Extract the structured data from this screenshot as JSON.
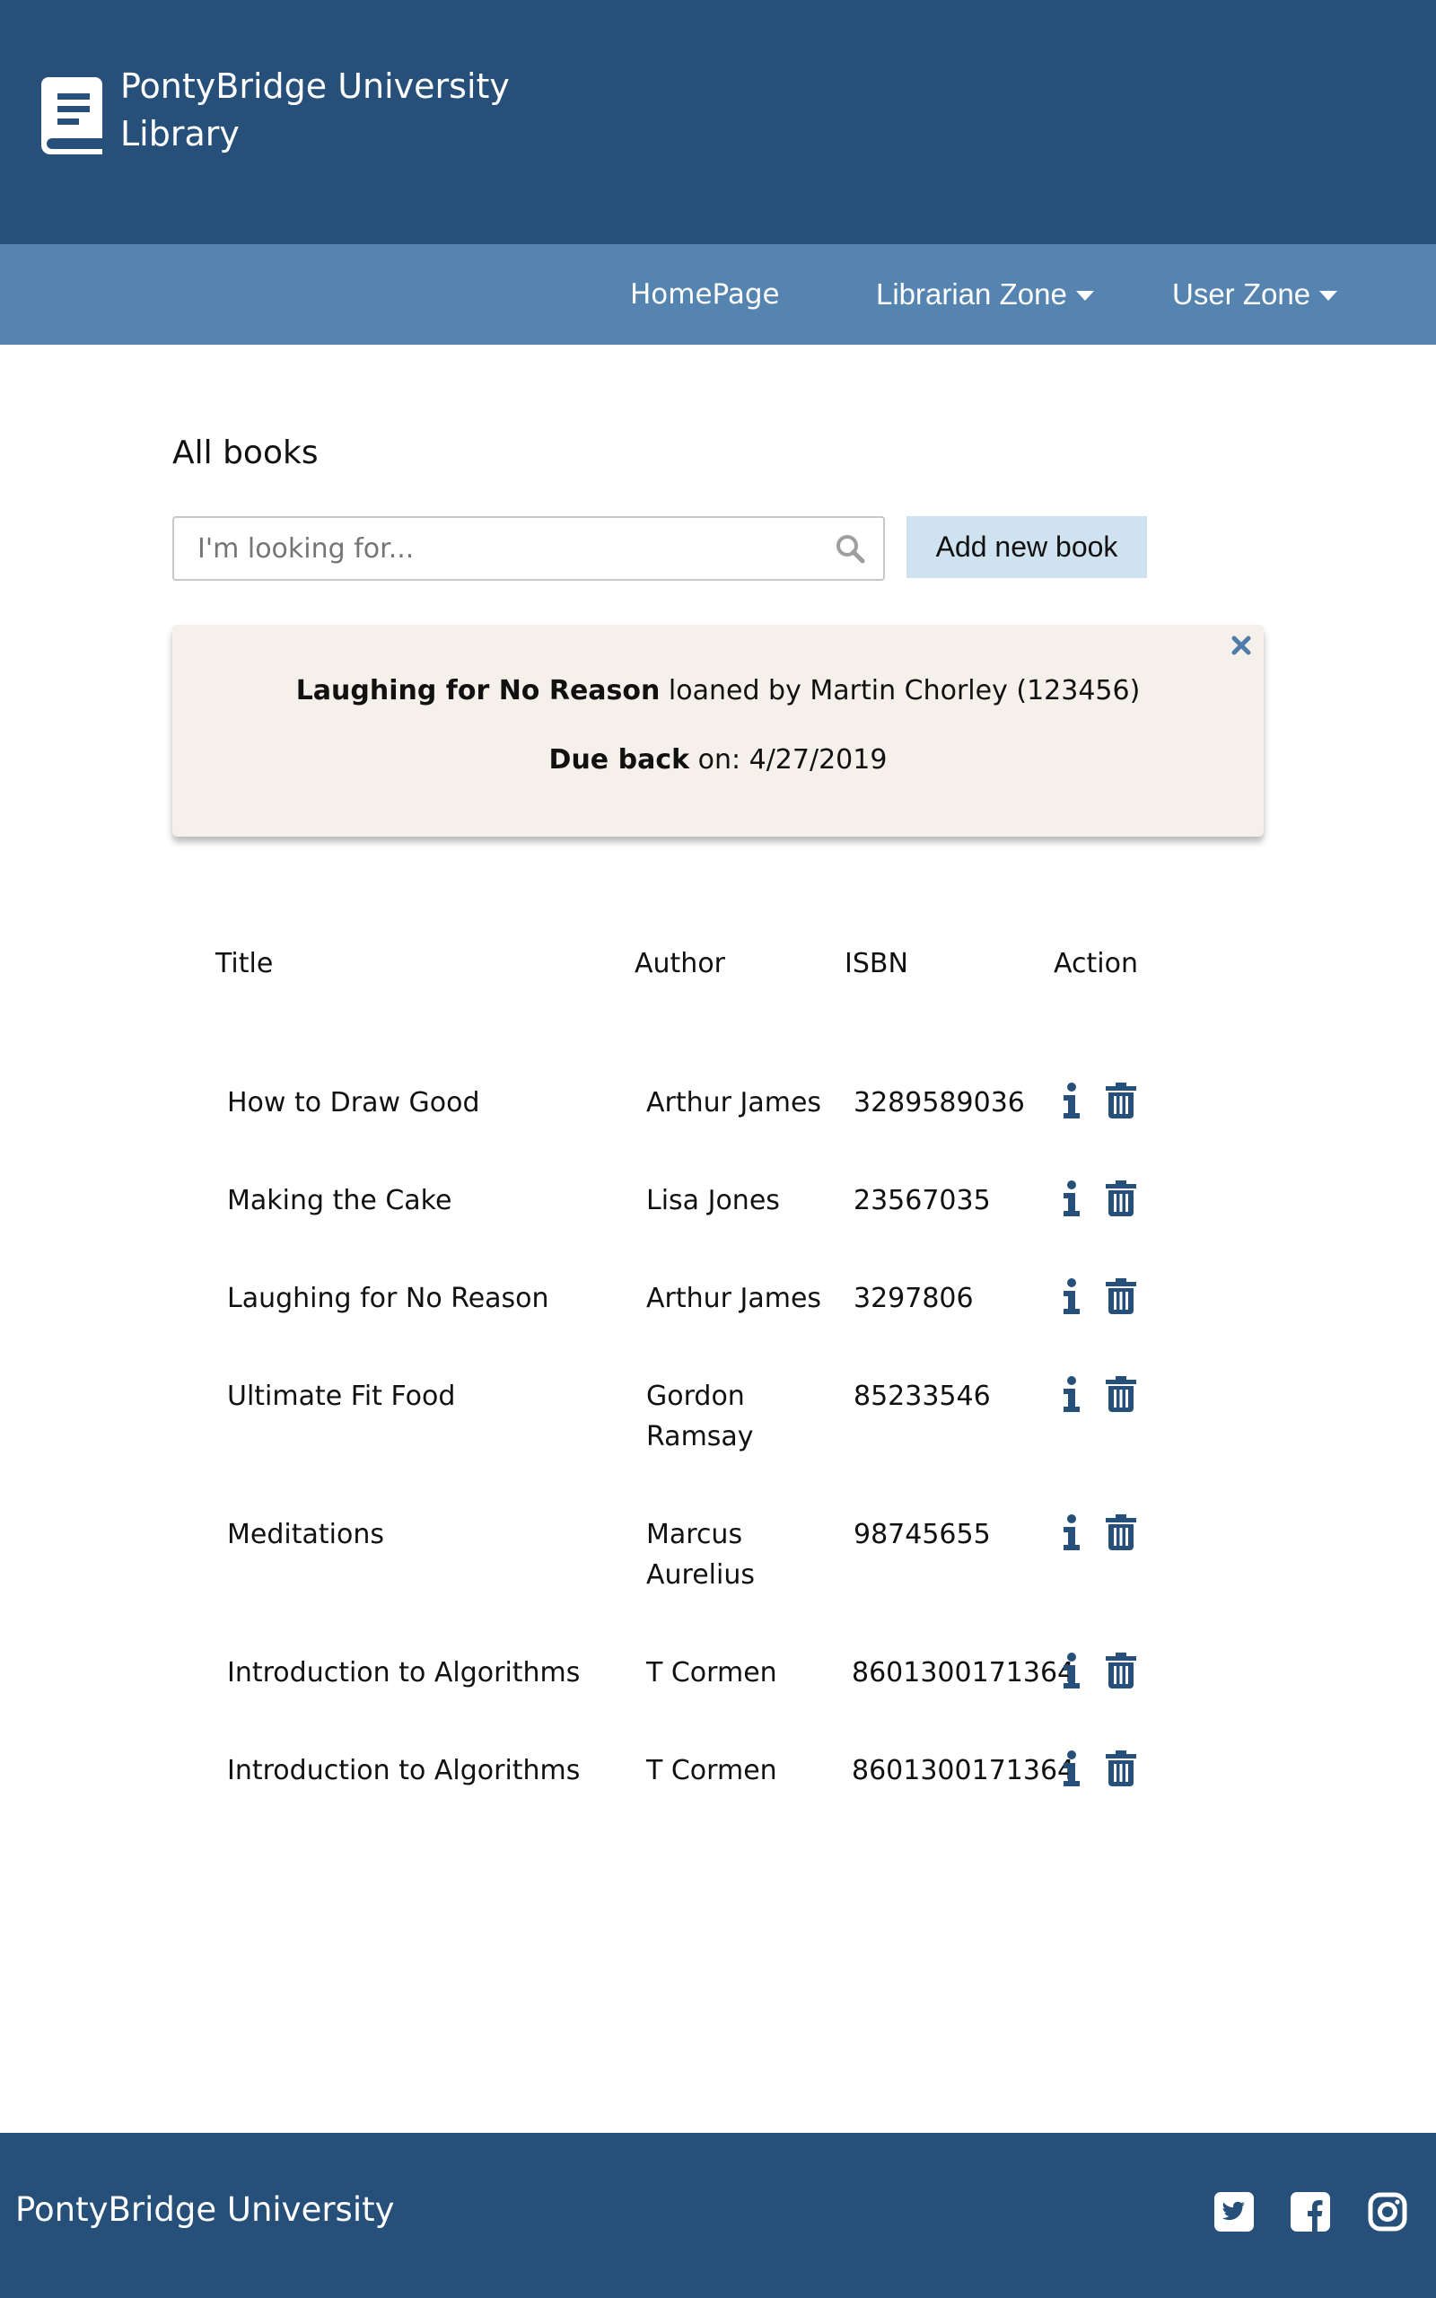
{
  "header": {
    "title_line1": "PontyBridge University",
    "title_line2": "Library",
    "logo_icon": "book-icon"
  },
  "nav": {
    "home": "HomePage",
    "librarian": "Librarian Zone",
    "user": "User Zone"
  },
  "page": {
    "title": "All books"
  },
  "search": {
    "placeholder": "I'm looking for...",
    "value": ""
  },
  "add_button": "Add new book",
  "notice": {
    "book_title": "Laughing for No Reason",
    "loaned_text": " loaned by Martin Chorley (123456)",
    "due_label": "Due back",
    "due_text": " on: 4/27/2019"
  },
  "table": {
    "headers": {
      "title": "Title",
      "author": "Author",
      "isbn": "ISBN",
      "action": "Action"
    },
    "rows": [
      {
        "title": "How to Draw Good",
        "author": "Arthur James",
        "isbn": "3289589036"
      },
      {
        "title": "Making the Cake",
        "author": "Lisa Jones",
        "isbn": "23567035"
      },
      {
        "title": "Laughing for No Reason",
        "author": "Arthur James",
        "isbn": "3297806"
      },
      {
        "title": "Ultimate Fit Food",
        "author": "Gordon Ramsay",
        "isbn": "85233546"
      },
      {
        "title": "Meditations",
        "author": "Marcus Aurelius",
        "isbn": "98745655"
      },
      {
        "title": "Introduction to Algorithms",
        "author": "T Cormen",
        "isbn": "8601300171364"
      },
      {
        "title": "Introduction to Algorithms",
        "author": "T Cormen",
        "isbn": "8601300171364"
      }
    ]
  },
  "footer": {
    "text": "PontyBridge University",
    "social": [
      "twitter-icon",
      "facebook-icon",
      "instagram-icon"
    ]
  },
  "colors": {
    "header_bg": "#264f7a",
    "nav_bg": "#5684b0",
    "button_bg": "#cfe2ef",
    "notice_bg": "#f5f1ea",
    "icon": "#264f7a"
  }
}
